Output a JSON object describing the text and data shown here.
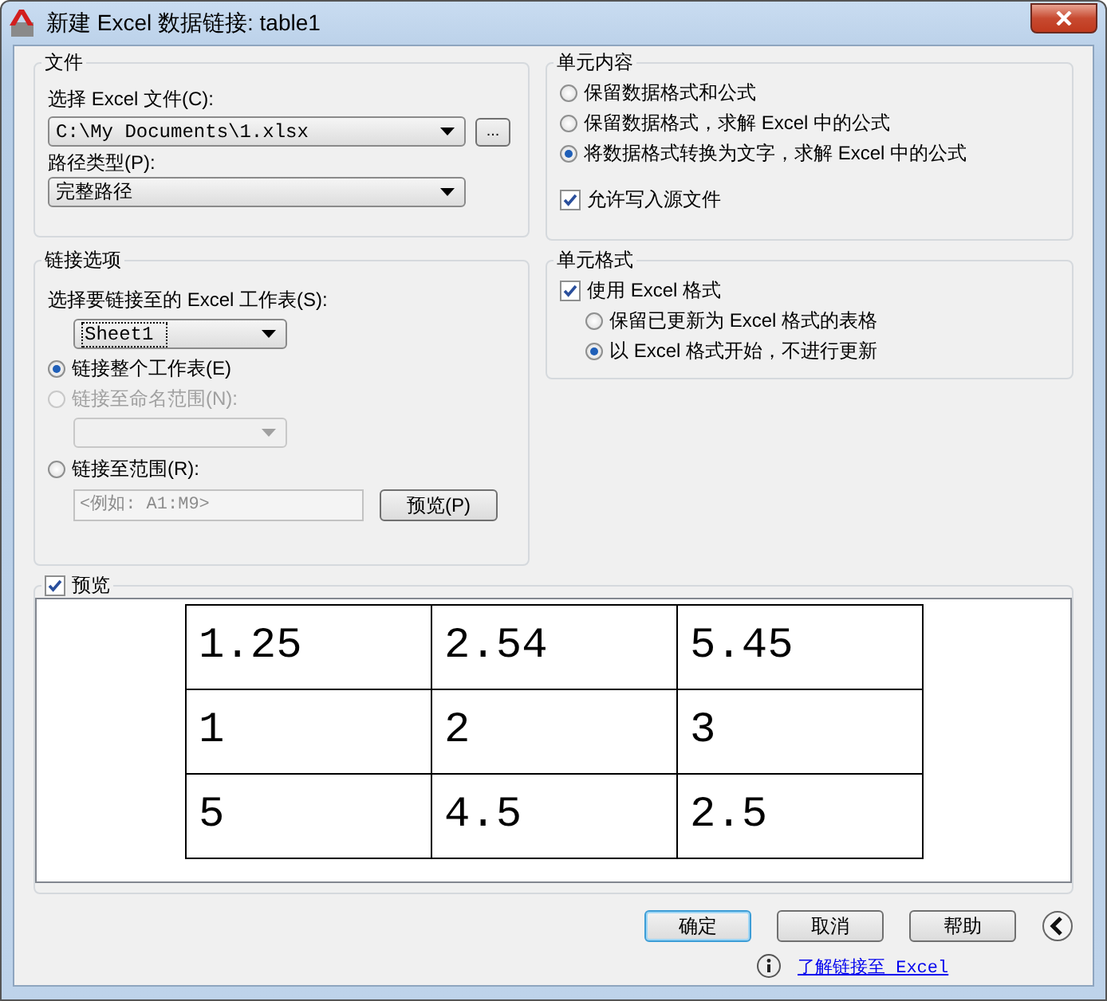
{
  "window": {
    "title": "新建 Excel 数据链接: table1"
  },
  "file_group": {
    "title": "文件",
    "file_label": "选择 Excel 文件(C):",
    "file_value": "C:\\My Documents\\1.xlsx",
    "browse_button": "...",
    "path_type_label": "路径类型(P):",
    "path_type_value": "完整路径"
  },
  "link_options": {
    "title": "链接选项",
    "sheet_label": "选择要链接至的 Excel 工作表(S):",
    "sheet_value": "Sheet1",
    "options": [
      {
        "label": "链接整个工作表(E)",
        "selected": true,
        "disabled": false
      },
      {
        "label": "链接至命名范围(N):",
        "selected": false,
        "disabled": true
      },
      {
        "label": "链接至范围(R):",
        "selected": false,
        "disabled": false
      }
    ],
    "named_range_dropdown": {
      "disabled": true
    },
    "range_field": {
      "placeholder": "<例如: A1:M9>"
    },
    "preview_button": "预览(P)"
  },
  "cell_contents": {
    "title": "单元内容",
    "options": [
      {
        "label": "保留数据格式和公式",
        "selected": false
      },
      {
        "label": "保留数据格式，求解 Excel 中的公式",
        "selected": false
      },
      {
        "label": "将数据格式转换为文字，求解 Excel 中的公式",
        "selected": true
      }
    ],
    "allow_write": {
      "label": "允许写入源文件",
      "checked": true
    }
  },
  "cell_format": {
    "title": "单元格式",
    "use_excel": {
      "label": "使用 Excel 格式",
      "checked": true
    },
    "options": [
      {
        "label": "保留已更新为 Excel 格式的表格",
        "selected": false
      },
      {
        "label": "以 Excel 格式开始，不进行更新",
        "selected": true
      }
    ]
  },
  "preview": {
    "label": "预览",
    "checked": true,
    "rows": [
      [
        "1.25",
        "2.54",
        "5.45"
      ],
      [
        "1",
        "2",
        "3"
      ],
      [
        "5",
        "4.5",
        "2.5"
      ]
    ]
  },
  "buttons": [
    {
      "label": "确定",
      "focused": true
    },
    {
      "label": "取消",
      "focused": false
    },
    {
      "label": "帮助",
      "focused": false
    }
  ],
  "help_link": "了解链接至 Excel"
}
